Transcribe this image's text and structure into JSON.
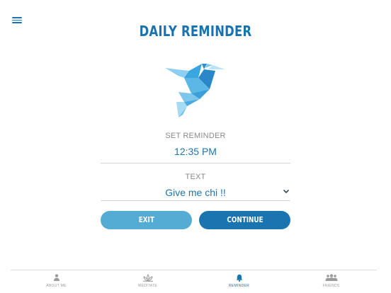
{
  "header": {
    "title": "DAILY REMINDER",
    "menu_icon": "hamburger-menu-icon"
  },
  "illustration": {
    "icon": "origami-bird-icon"
  },
  "reminder": {
    "label": "SET REMINDER",
    "time": "12:35 PM"
  },
  "text_field": {
    "label": "TEXT",
    "value": "Give me chi !!",
    "icon": "chevron-down-icon"
  },
  "buttons": {
    "exit": "EXIT",
    "continue": "CONTINUE"
  },
  "tabs": [
    {
      "label": "ABOUT ME",
      "icon": "person-icon",
      "active": false
    },
    {
      "label": "MEDITATE",
      "icon": "lotus-icon",
      "active": false
    },
    {
      "label": "REMINDER",
      "icon": "bell-icon",
      "active": true
    },
    {
      "label": "FRIENDS",
      "icon": "group-icon",
      "active": false
    }
  ],
  "colors": {
    "primary": "#1a74b0",
    "secondary": "#54acd4",
    "muted": "#8a8a8a",
    "divider": "#d6d6d6"
  }
}
